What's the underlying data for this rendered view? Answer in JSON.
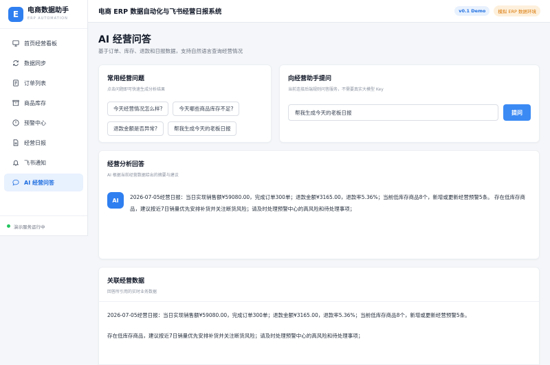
{
  "brand": {
    "logo": "E",
    "name": "电商数据助手",
    "subtitle": "ERP AUTOMATION"
  },
  "nav": [
    {
      "label": "首页经营看板",
      "icon": "monitor-icon",
      "active": false
    },
    {
      "label": "数据同步",
      "icon": "sync-icon",
      "active": false
    },
    {
      "label": "订单列表",
      "icon": "document-icon",
      "active": false
    },
    {
      "label": "商品库存",
      "icon": "box-icon",
      "active": false
    },
    {
      "label": "预警中心",
      "icon": "alert-icon",
      "active": false
    },
    {
      "label": "经营日报",
      "icon": "report-icon",
      "active": false
    },
    {
      "label": "飞书通知",
      "icon": "bell-icon",
      "active": false
    },
    {
      "label": "AI 经营问答",
      "icon": "chat-icon",
      "active": true
    }
  ],
  "sidebar_footer": {
    "status": "演示服务运行中"
  },
  "header": {
    "title": "电商 ERP 数据自动化与飞书经营日报系统",
    "version_badge": "v0.1 Demo",
    "env_badge": "模拟 ERP 数据环境"
  },
  "page": {
    "title": "AI 经营问答",
    "subtitle": "基于订单、库存、退款和日报数据，支持自然语言查询经营情况"
  },
  "questions_card": {
    "title": "常用经营问题",
    "desc": "点击问题即可快速生成分析结果",
    "chips": [
      "今天经营情况怎么样?",
      "今天哪些商品库存不足?",
      "退款金额是否异常?",
      "帮我生成今天的老板日报"
    ]
  },
  "ask_card": {
    "title": "向经营助手提问",
    "desc": "当前连接后端规则问答服务，不需要真实大模型 Key",
    "input_value": "帮我生成今天的老板日报",
    "button": "提问"
  },
  "answer_card": {
    "title": "经营分析回答",
    "desc": "AI 根据当前经营数据给出的摘要与建议",
    "avatar": "AI",
    "text": "2026-07-05经营日报：当日实现销售额¥59080.00，完成订单300单；退款金额¥3165.00，退款率5.36%；当前低库存商品8个，新增或更新经营预警5条。 存在低库存商品，建议按近7日销量优先安排补货并关注断货风险；请及时处理预警中心的高风险和待处理事项；"
  },
  "related_card": {
    "title": "关联经营数据",
    "desc": "回答所引用的实时业务数据",
    "lines": [
      "2026-07-05经营日报：当日实现销售额¥59080.00，完成订单300单；退款金额¥3165.00，退款率5.36%；当前低库存商品8个，新增或更新经营预警5条。",
      "存在低库存商品，建议按近7日销量优先安排补货并关注断货风险；请及时处理预警中心的高风险和待处理事项；"
    ]
  },
  "colors": {
    "accent": "#2f7ff0",
    "active_bg": "#e8f1fe",
    "status_green": "#22c55e",
    "env_badge": "#d97706"
  }
}
